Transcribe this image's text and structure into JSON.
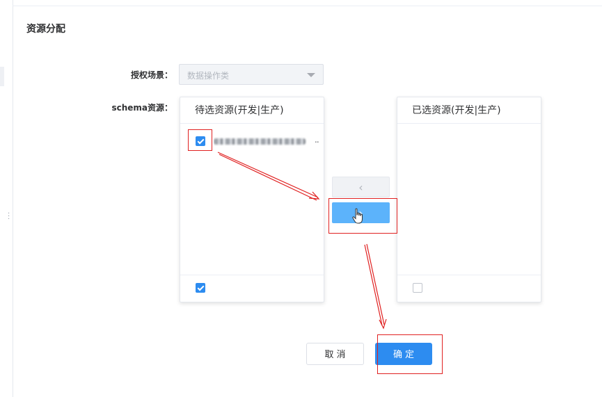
{
  "page": {
    "title": "资源分配"
  },
  "form": {
    "scene_label": "授权场景：",
    "scene_value": "数据操作类",
    "schema_label": "schema资源："
  },
  "transfer": {
    "left_panel": {
      "title": "待选资源(开发|生产)",
      "items": [
        {
          "text_obscured": true,
          "ellipsis": "..",
          "checked": true
        }
      ],
      "select_all_checked": true
    },
    "right_panel": {
      "title": "已选资源(开发|生产)",
      "items": [],
      "select_all_checked": false
    },
    "move_left_symbol": "‹",
    "move_right_symbol": "›"
  },
  "actions": {
    "cancel_label": "取消",
    "confirm_label": "确定"
  },
  "colors": {
    "primary": "#2d8cf0",
    "primary_light": "#5cb3fb",
    "annotation_red": "#e02020"
  }
}
